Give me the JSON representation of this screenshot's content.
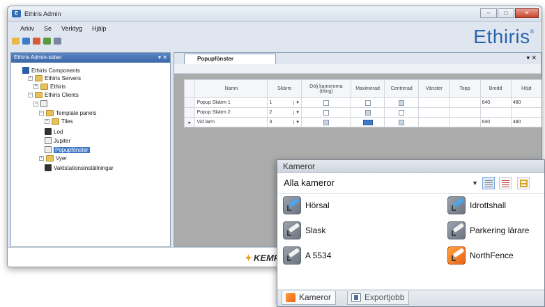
{
  "window": {
    "title": "Ethiris Admin",
    "brand": "Ethiris",
    "brand_mark": "®",
    "menu": [
      "Arkiv",
      "Se",
      "Verktyg",
      "Hjälp"
    ]
  },
  "left_panel": {
    "title": "Ethiris Admin-sidan",
    "tree": [
      {
        "label": "Ethiris Components"
      },
      {
        "label": "Ethiris Servers"
      },
      {
        "label": "Ethiris"
      },
      {
        "label": "Ethiris Clients"
      },
      {
        "label": ""
      },
      {
        "label": "Template panels"
      },
      {
        "label": "Tiles"
      },
      {
        "label": "Lod"
      },
      {
        "label": "Jupiter"
      },
      {
        "label": "Popupfönster"
      },
      {
        "label": "Vyer"
      },
      {
        "label": "Vaktstationsinställningar"
      }
    ]
  },
  "document": {
    "tab": "Popupfönster",
    "columns": [
      "Namn",
      "Skärm",
      "Dölj kamerorna (tiling)",
      "Maximerad",
      "Centrerad",
      "Vänster",
      "Topp",
      "Bredd",
      "Höjd"
    ],
    "rows": [
      {
        "name": "Popup Skärm 1",
        "screen": "1",
        "width": "640",
        "height": "480",
        "selected": false
      },
      {
        "name": "Popup Skärm 2",
        "screen": "2",
        "width": "",
        "height": "",
        "selected": false
      },
      {
        "name": "Vid larm",
        "screen": "3",
        "width": "640",
        "height": "480",
        "selected": true
      }
    ],
    "row_marker": "▸"
  },
  "status": {
    "vendor": "KEMP"
  },
  "kameror": {
    "title": "Kameror",
    "filter": "Alla kameror",
    "cameras": [
      {
        "name": "Hörsal",
        "icon": "blue"
      },
      {
        "name": "Idrottshall",
        "icon": "blue"
      },
      {
        "name": "Slask",
        "icon": "white"
      },
      {
        "name": "Parkering lärare",
        "icon": "white"
      },
      {
        "name": "A 5534",
        "icon": "white"
      },
      {
        "name": "NorthFence",
        "icon": "orange"
      }
    ],
    "tabs": [
      "Kameror",
      "Exportjobb"
    ]
  },
  "colors": {
    "brand_blue": "#2a64ad",
    "selection_blue": "#3d78c9",
    "orange_accent": "#e8631a"
  }
}
